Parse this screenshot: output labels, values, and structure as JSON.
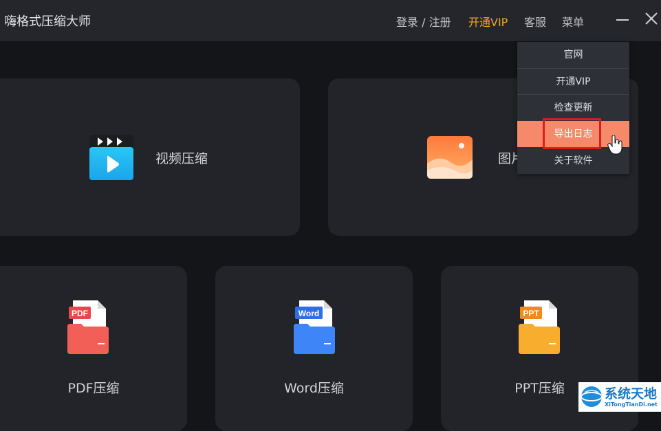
{
  "app": {
    "title": "嗨格式压缩大师"
  },
  "header": {
    "login_label": "登录 / 注册",
    "vip_label": "开通VIP",
    "service_label": "客服",
    "menu_label": "菜单",
    "vip_color": "#f6a623"
  },
  "cards": {
    "video": {
      "label": "视频压缩",
      "icon": "video-clapper-icon"
    },
    "image": {
      "label": "图片",
      "icon": "image-landscape-icon"
    },
    "pdf": {
      "label": "PDF压缩",
      "icon": "pdf-file-icon",
      "badge": "PDF"
    },
    "word": {
      "label": "Word压缩",
      "icon": "word-file-icon",
      "badge": "Word"
    },
    "ppt": {
      "label": "PPT压缩",
      "icon": "ppt-file-icon",
      "badge": "PPT"
    }
  },
  "menu": {
    "items": [
      {
        "label": "官网"
      },
      {
        "label": "开通VIP"
      },
      {
        "label": "检查更新"
      },
      {
        "label": "导出日志",
        "active": true
      },
      {
        "label": "关于软件"
      }
    ],
    "active_color": "#f5896a"
  },
  "watermark": {
    "title": "系统天地",
    "subtitle": "XiTongTianDi.net"
  }
}
